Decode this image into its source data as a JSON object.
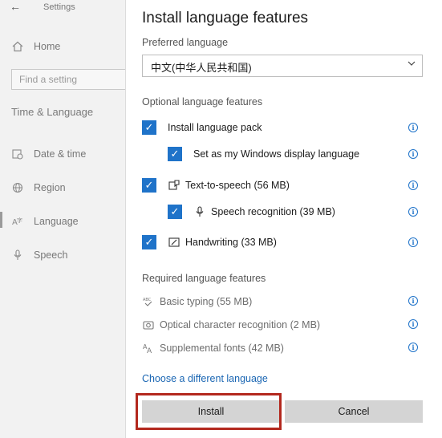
{
  "settings": {
    "back_glyph": "←",
    "app_title": "Settings",
    "nav": {
      "home": "Home",
      "find_placeholder": "Find a setting",
      "section": "Time & Language",
      "date_time": "Date & time",
      "region": "Region",
      "language": "Language",
      "speech": "Speech"
    }
  },
  "dialog": {
    "title": "Install language features",
    "preferred_label": "Preferred language",
    "preferred_value": "中文(中华人民共和国)",
    "optional_label": "Optional language features",
    "options": [
      {
        "label": "Install language pack",
        "checked": true
      },
      {
        "label": "Set as my Windows display language",
        "checked": true
      },
      {
        "label": "Text-to-speech (56 MB)",
        "checked": true,
        "icon": "text-to-speech-icon"
      },
      {
        "label": "Speech recognition (39 MB)",
        "checked": true,
        "icon": "microphone-icon"
      },
      {
        "label": "Handwriting (33 MB)",
        "checked": true,
        "icon": "pen-icon"
      }
    ],
    "required_label": "Required language features",
    "required": [
      {
        "label": "Basic typing (55 MB)",
        "icon": "abc-check-icon"
      },
      {
        "label": "Optical character recognition (2 MB)",
        "icon": "camera-icon"
      },
      {
        "label": "Supplemental fonts (42 MB)",
        "icon": "font-icon"
      }
    ],
    "change_link": "Choose a different language",
    "install_label": "Install",
    "cancel_label": "Cancel"
  },
  "colors": {
    "accent": "#1f73c9",
    "highlight": "#b3281e"
  }
}
